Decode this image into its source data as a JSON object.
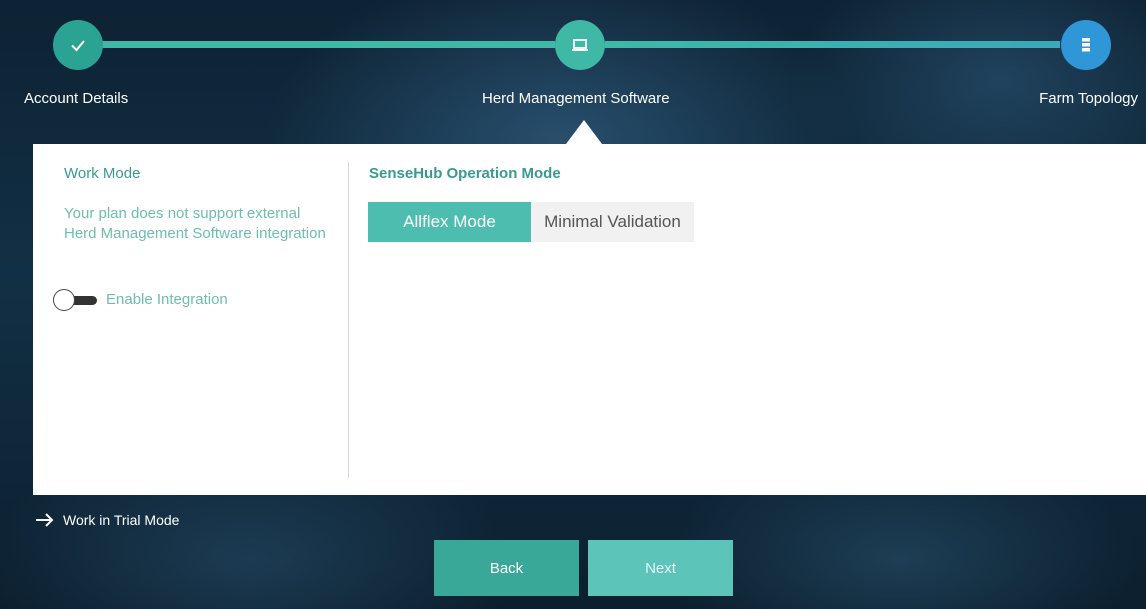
{
  "stepper": {
    "steps": [
      {
        "label": "Account Details",
        "icon": "check-icon",
        "state": "completed",
        "color": "#2aa393"
      },
      {
        "label": "Herd Management Software",
        "icon": "laptop-icon",
        "state": "current",
        "color": "#3fb8a6"
      },
      {
        "label": "Farm Topology",
        "icon": "server-icon",
        "state": "upcoming",
        "color": "#2f97d8"
      }
    ]
  },
  "work_mode": {
    "title": "Work Mode",
    "description": "Your plan does not support external Herd Management Software integration",
    "toggle_label": "Enable Integration",
    "toggle_on": false
  },
  "operation_mode": {
    "title": "SenseHub Operation Mode",
    "options": [
      "Allflex Mode",
      "Minimal Validation"
    ],
    "selected": "Allflex Mode"
  },
  "footer": {
    "trial_link": "Work in Trial Mode",
    "back_label": "Back",
    "next_label": "Next"
  },
  "colors": {
    "accent": "#3fb8a6",
    "accent_dark": "#3a9a8f",
    "step3": "#2f97d8"
  }
}
